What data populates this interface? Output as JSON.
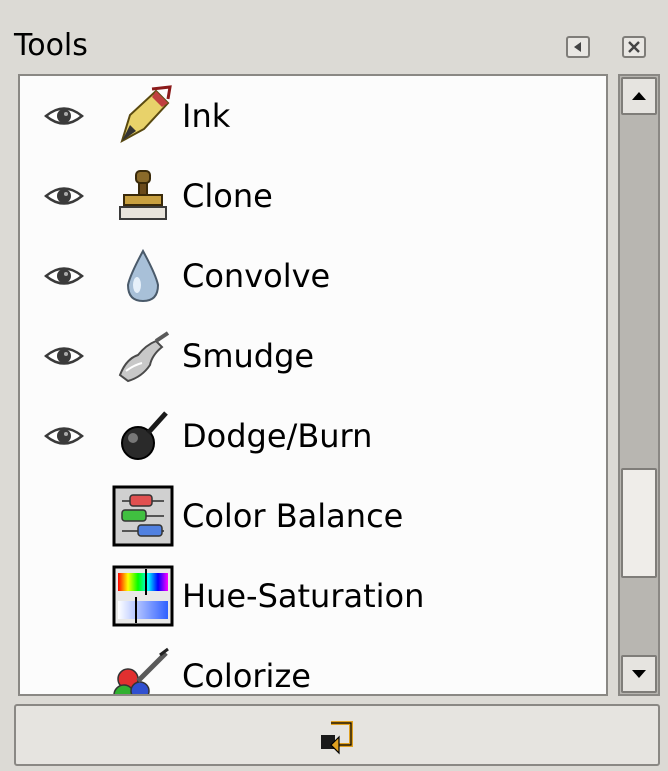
{
  "panel": {
    "title": "Tools"
  },
  "tools": [
    {
      "name": "Ink",
      "visible": true,
      "icon": "ink-pen-icon"
    },
    {
      "name": "Clone",
      "visible": true,
      "icon": "clone-stamp-icon"
    },
    {
      "name": "Convolve",
      "visible": true,
      "icon": "convolve-drop-icon"
    },
    {
      "name": "Smudge",
      "visible": true,
      "icon": "smudge-finger-icon"
    },
    {
      "name": "Dodge/Burn",
      "visible": true,
      "icon": "dodge-burn-icon"
    },
    {
      "name": "Color Balance",
      "visible": false,
      "icon": "color-balance-icon"
    },
    {
      "name": "Hue-Saturation",
      "visible": false,
      "icon": "hue-saturation-icon"
    },
    {
      "name": "Colorize",
      "visible": false,
      "icon": "colorize-icon"
    }
  ],
  "colors": {
    "background": "#dcdad5",
    "list_background": "#fcfcfc",
    "eye": "#3a3a3a"
  }
}
